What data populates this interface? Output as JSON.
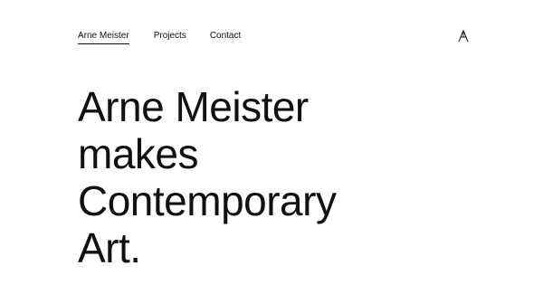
{
  "nav": {
    "items": [
      {
        "label": "Arne Meister",
        "active": true
      },
      {
        "label": "Projects",
        "active": false
      },
      {
        "label": "Contact",
        "active": false
      }
    ],
    "logo_icon": "monogram-a-icon"
  },
  "hero": {
    "lines": [
      "Arne Meister",
      "makes",
      "Contemporary",
      "Art."
    ]
  },
  "colors": {
    "text": "#111111",
    "background": "#ffffff"
  }
}
